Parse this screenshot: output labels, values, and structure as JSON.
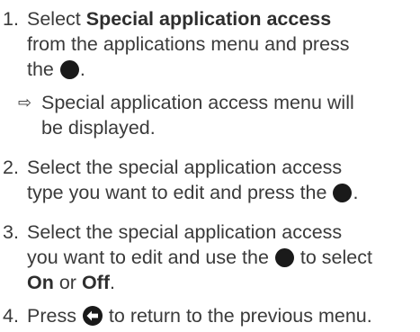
{
  "steps": [
    {
      "number": "1.",
      "pre": "Select ",
      "bold": "Special application access",
      "line2": "from the applications menu and press",
      "line3_pre": "the ",
      "line3_post": "."
    },
    {
      "number": "2.",
      "line1": "Select the special application access",
      "line2_pre": "type you want to edit and press the ",
      "line2_post": "."
    },
    {
      "number": "3.",
      "line1": "Select the special application access",
      "line2_pre": "you want to edit and use the ",
      "line2_post": " to select",
      "bold_on": "On",
      "or": " or ",
      "bold_off": "Off",
      "end": "."
    },
    {
      "number": "4.",
      "pre": "Press ",
      "post": " to return to the previous menu."
    }
  ],
  "result": {
    "symbol": "⇨",
    "line1": "Special application access menu will",
    "line2": "be displayed."
  },
  "icons": {
    "ok_button": "filled-circle-icon",
    "back_button": "back-arrow-circle-icon"
  }
}
